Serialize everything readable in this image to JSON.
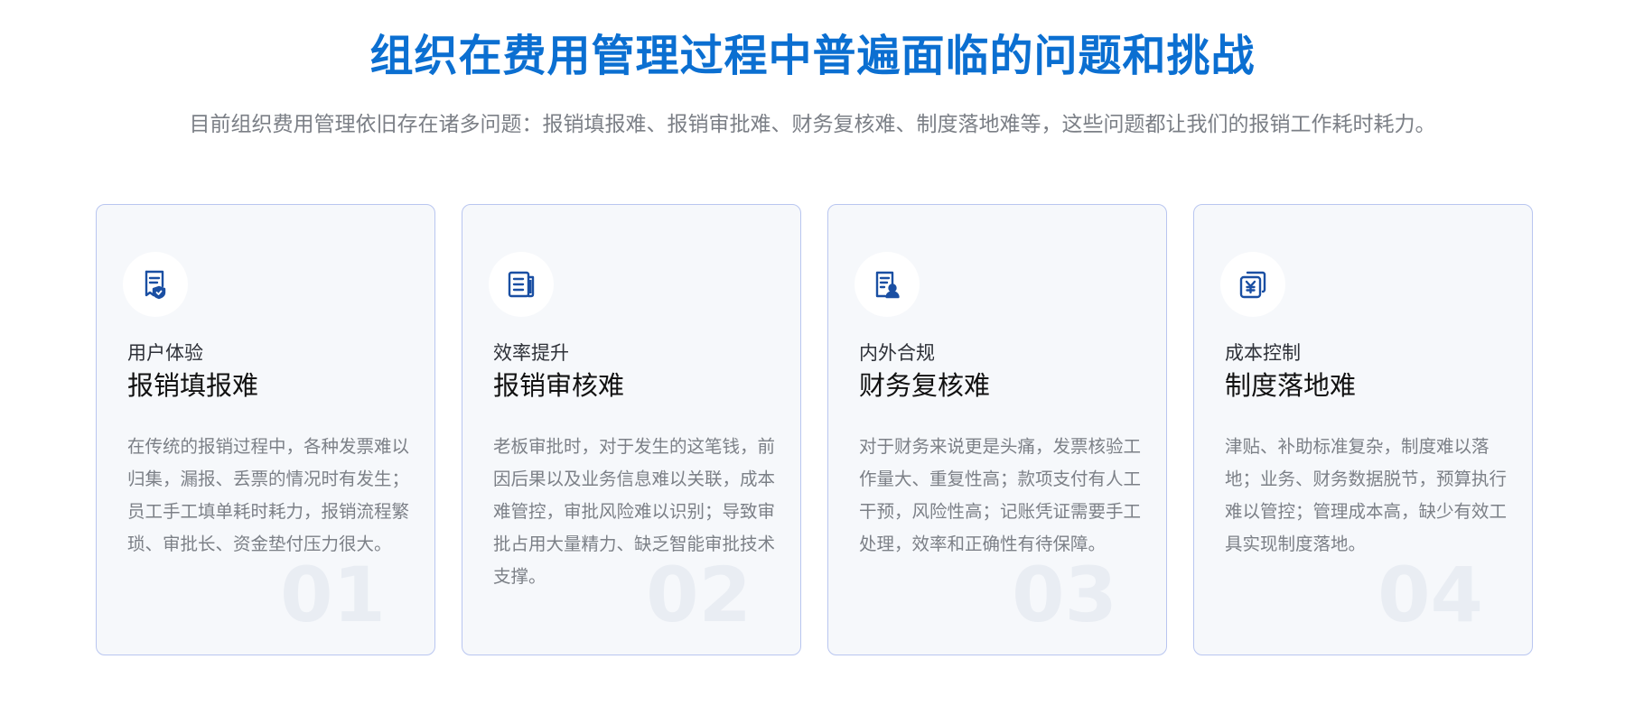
{
  "header": {
    "title": "组织在费用管理过程中普遍面临的问题和挑战",
    "subtitle": "目前组织费用管理依旧存在诸多问题：报销填报难、报销审批难、财务复核难、制度落地难等，这些问题都让我们的报销工作耗时耗力。"
  },
  "colors": {
    "accent": "#0b6fd1",
    "icon": "#1a4fa3",
    "card_border": "#b9c6f0",
    "card_bg": "#f6f8fb"
  },
  "cards": [
    {
      "icon": "receipt-shield-icon",
      "tag": "用户体验",
      "title": "报销填报难",
      "desc": "在传统的报销过程中，各种发票难以归集，漏报、丢票的情况时有发生；员工手工填单耗时耗力，报销流程繁琐、审批长、资金垫付压力很大。",
      "num": "01"
    },
    {
      "icon": "document-list-icon",
      "tag": "效率提升",
      "title": "报销审核难",
      "desc": "老板审批时，对于发生的这笔钱，前因后果以及业务信息难以关联，成本难管控，审批风险难以识别；导致审批占用大量精力、缺乏智能审批技术支撑。",
      "num": "02"
    },
    {
      "icon": "document-user-icon",
      "tag": "内外合规",
      "title": "财务复核难",
      "desc": "对于财务来说更是头痛，发票核验工作量大、重复性高；款项支付有人工干预，风险性高；记账凭证需要手工处理，效率和正确性有待保障。",
      "num": "03"
    },
    {
      "icon": "yuan-document-icon",
      "tag": "成本控制",
      "title": "制度落地难",
      "desc": "津贴、补助标准复杂，制度难以落地；业务、财务数据脱节，预算执行难以管控；管理成本高，缺少有效工具实现制度落地。",
      "num": "04"
    }
  ]
}
